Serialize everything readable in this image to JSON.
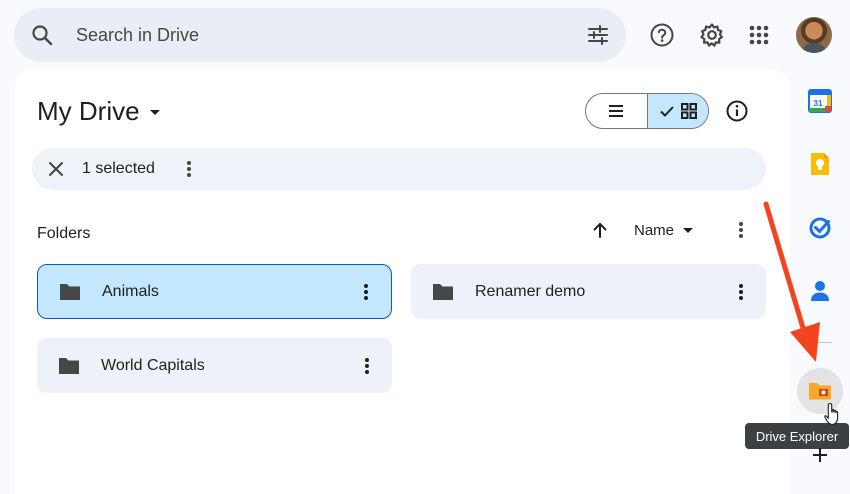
{
  "search": {
    "placeholder": "Search in Drive",
    "icons": [
      "search-icon",
      "tune-icon"
    ]
  },
  "header": {
    "icons": [
      "help-icon",
      "settings-icon",
      "apps-grid-icon",
      "avatar"
    ]
  },
  "main": {
    "title": "My Drive",
    "view_toggle": {
      "options": [
        "list",
        "grid"
      ],
      "selected": "grid"
    },
    "selection_bar": {
      "count_label": "1 selected"
    },
    "section_label": "Folders",
    "sort": {
      "field_label": "Name",
      "direction": "ascending"
    },
    "folders": [
      {
        "name": "Animals",
        "selected": true
      },
      {
        "name": "Renamer demo",
        "selected": false
      },
      {
        "name": "World Capitals",
        "selected": false
      }
    ]
  },
  "side_panel": {
    "apps": [
      "calendar-icon",
      "keep-icon",
      "tasks-icon",
      "contacts-icon"
    ],
    "addon": {
      "name": "drive-explorer-icon",
      "tooltip": "Drive Explorer"
    },
    "calendar_day": "31"
  },
  "colors": {
    "accent": "#0b57d0",
    "selected_bg": "#c2e7ff",
    "annotation_arrow": "#f4431f"
  }
}
